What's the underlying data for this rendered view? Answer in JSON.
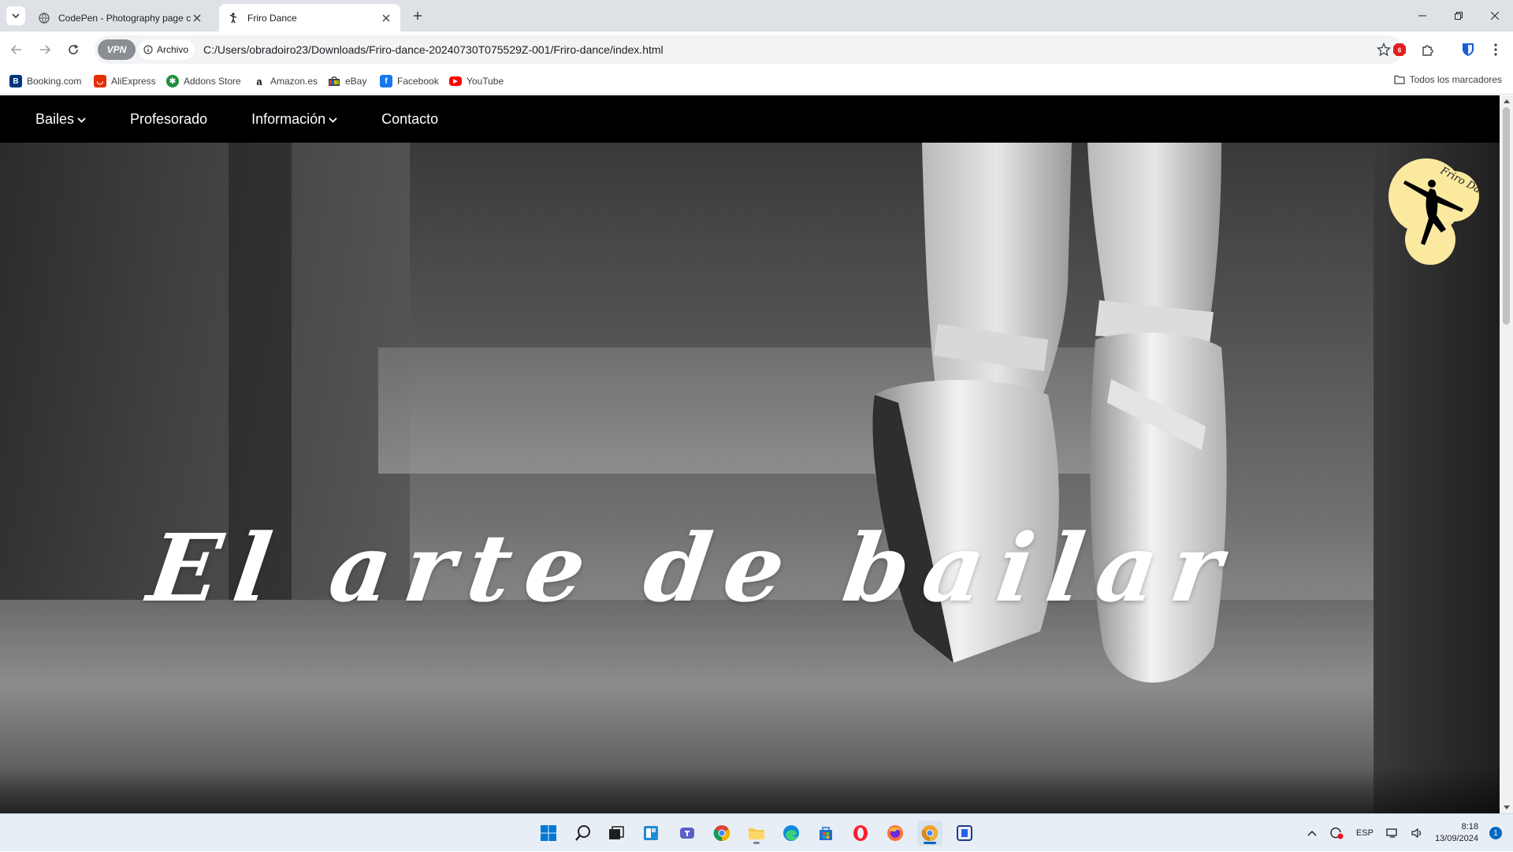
{
  "browser": {
    "tabs": [
      {
        "title": "CodePen - Photography page c",
        "active": false,
        "favicon": "codepen-icon"
      },
      {
        "title": "Friro Dance",
        "active": true,
        "favicon": "dancer-icon"
      }
    ],
    "address": {
      "vpn_label": "VPN",
      "scheme_label": "Archivo",
      "url": "C:/Users/obradoiro23/Downloads/Friro-dance-20240730T075529Z-001/Friro-dance/index.html"
    },
    "bookmarks": [
      {
        "label": "Booking.com",
        "icon": "booking-icon",
        "color": "#003580"
      },
      {
        "label": "AliExpress",
        "icon": "aliexpress-icon",
        "color": "#e62e04"
      },
      {
        "label": "Addons Store",
        "icon": "addons-icon",
        "color": "#1e8e3e"
      },
      {
        "label": "Amazon.es",
        "icon": "amazon-icon",
        "color": "#111111"
      },
      {
        "label": "eBay",
        "icon": "ebay-icon",
        "color": "#444444"
      },
      {
        "label": "Facebook",
        "icon": "facebook-icon",
        "color": "#1877f2"
      },
      {
        "label": "YouTube",
        "icon": "youtube-icon",
        "color": "#ff0000"
      }
    ],
    "all_bookmarks": "Todos los marcadores"
  },
  "site": {
    "nav": [
      {
        "label": "Bailes",
        "dropdown": true
      },
      {
        "label": "Profesorado",
        "dropdown": false
      },
      {
        "label": "Información",
        "dropdown": true
      },
      {
        "label": "Contacto",
        "dropdown": false
      }
    ],
    "hero_title": "El arte de bailar",
    "logo_text": "Friro Dance",
    "logo_color": "#fbe9a0"
  },
  "taskbar": {
    "apps": [
      "windows-start-icon",
      "search-icon",
      "task-view-icon",
      "widgets-icon",
      "teams-icon",
      "chrome-icon",
      "file-explorer-icon",
      "edge-icon",
      "store-icon",
      "opera-icon",
      "firefox-icon",
      "chrome-canary-icon",
      "capture-icon"
    ],
    "language": "ESP",
    "time": "8:18",
    "date": "13/09/2024",
    "notifications": "1"
  }
}
